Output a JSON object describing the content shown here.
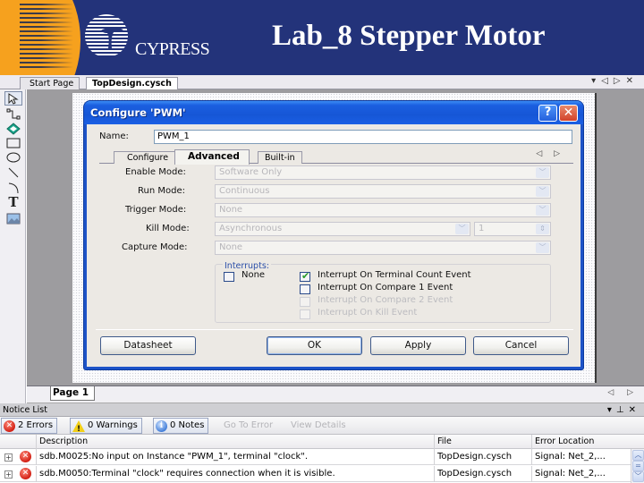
{
  "slide": {
    "title": "Lab_8 Stepper Motor",
    "brand": "CYPRESS"
  },
  "doc_tabs": [
    {
      "label": "Start Page",
      "active": false
    },
    {
      "label": "TopDesign.cysch",
      "active": true
    }
  ],
  "doc_tab_controls": {
    "dropdown": "▾",
    "prev": "◁",
    "next": "▷",
    "close": "✕"
  },
  "palette": [
    {
      "name": "pointer-tool",
      "glyph": "⇱"
    },
    {
      "name": "wire-tool",
      "glyph": "⌐"
    },
    {
      "name": "component-tool",
      "glyph": "◈"
    },
    {
      "name": "rectangle-tool",
      "glyph": "▭"
    },
    {
      "name": "ellipse-tool",
      "glyph": "◯"
    },
    {
      "name": "line-tool",
      "glyph": "╲"
    },
    {
      "name": "arc-tool",
      "glyph": "⌒"
    },
    {
      "name": "text-tool",
      "glyph": "T"
    },
    {
      "name": "image-tool",
      "glyph": "▨"
    }
  ],
  "dialog": {
    "title": "Configure 'PWM'",
    "help_glyph": "?",
    "close_glyph": "✕",
    "name_label": "Name:",
    "name_value": "PWM_1",
    "tabs": [
      {
        "label": "Configure",
        "active": false
      },
      {
        "label": "Advanced",
        "active": true
      },
      {
        "label": "Built-in",
        "active": false
      }
    ],
    "tab_arrows": "◁ ▷",
    "fields": [
      {
        "label": "Enable Mode:",
        "value": "Software Only",
        "enabled": false
      },
      {
        "label": "Run Mode:",
        "value": "Continuous",
        "enabled": false
      },
      {
        "label": "Trigger Mode:",
        "value": "None",
        "enabled": false
      },
      {
        "label": "Kill Mode:",
        "value": "Asynchronous",
        "enabled": false,
        "spinner_value": "1"
      },
      {
        "label": "Capture Mode:",
        "value": "None",
        "enabled": false
      }
    ],
    "interrupts": {
      "legend": "Interrupts:",
      "none": {
        "label": "None",
        "checked": false,
        "enabled": true
      },
      "options": [
        {
          "label": "Interrupt On Terminal Count Event",
          "checked": true,
          "enabled": true
        },
        {
          "label": "Interrupt On Compare 1 Event",
          "checked": false,
          "enabled": true
        },
        {
          "label": "Interrupt On Compare 2 Event",
          "checked": false,
          "enabled": false
        },
        {
          "label": "Interrupt On Kill Event",
          "checked": false,
          "enabled": false
        }
      ]
    },
    "buttons": {
      "datasheet": "Datasheet",
      "ok": "OK",
      "apply": "Apply",
      "cancel": "Cancel"
    }
  },
  "page_tab": {
    "label": "Page 1",
    "arrows": "◁ ▷"
  },
  "notice_list": {
    "title": "Notice List",
    "controls": "▾ ⊥ ✕",
    "toolbar": {
      "errors": "2 Errors",
      "warnings": "0 Warnings",
      "notes": "0 Notes",
      "go_to_error": "Go To Error",
      "view_details": "View Details"
    },
    "columns": [
      "Description",
      "File",
      "Error Location"
    ],
    "rows": [
      {
        "description": "sdb.M0025:No input on Instance \"PWM_1\", terminal \"clock\".",
        "file": "TopDesign.cysch",
        "location": "Signal:  Net_2,..."
      },
      {
        "description": "sdb.M0050:Terminal \"clock\" requires connection when it is visible.",
        "file": "TopDesign.cysch",
        "location": "Signal:  Net_2,..."
      }
    ]
  },
  "colors": {
    "banner": "#23337a",
    "banner_accent": "#f6a11e",
    "dialog_title": "#1656d6",
    "error": "#d21f14"
  }
}
